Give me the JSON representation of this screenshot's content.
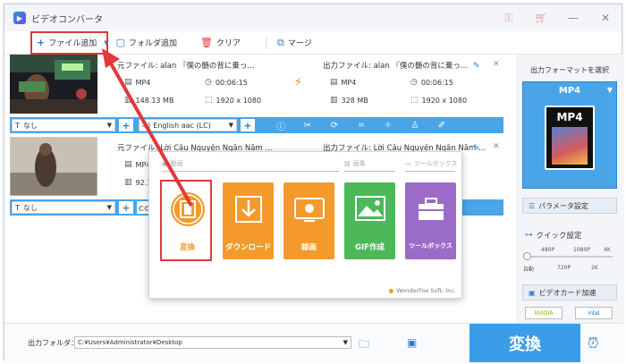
{
  "app": {
    "title": "ビデオコンバータ"
  },
  "toolbar": {
    "add_file": "ファイル追加",
    "add_folder": "フォルダ追加",
    "clear": "クリア",
    "merge": "マージ"
  },
  "files": [
    {
      "source_name": "元ファイル: alan 『僕の髄の背に乗っ...",
      "format": "MP4",
      "duration": "00:06:15",
      "size": "148.13 MB",
      "resolution": "1920 x 1080",
      "output_name": "出力ファイル: alan 『僕の髄の背に乗っ...",
      "out_format": "MP4",
      "out_duration": "00:06:15",
      "out_size": "328 MB",
      "out_resolution": "1920 x 1080",
      "subtitle": "なし",
      "audio": "English aac (LC)"
    },
    {
      "source_name": "元ファイル: Lời Câu Nguyện Ngân Năm ...",
      "format": "MP4",
      "size": "92.1",
      "output_name": "出力ファイル: Lời Câu Nguyện Ngân Năm ...",
      "subtitle": "なし"
    }
  ],
  "right_panel": {
    "title": "出力フォーマットを選択",
    "format": "MP4",
    "format_card": "MP4",
    "param_button": "パラメータ設定",
    "quick_settings": "クイック設定",
    "quality_top": [
      "480P",
      "1080P",
      "4K"
    ],
    "quality_bottom": [
      "自動",
      "720P",
      "2K"
    ],
    "gpu_button": "ビデオカード加速",
    "gpu_badges": [
      "NVIDIA",
      "intel"
    ]
  },
  "popup": {
    "section_video": "動画",
    "section_image": "画像",
    "section_toolbox": "ツールボックス",
    "tiles": [
      {
        "label": "変換",
        "color": "#f39a2b"
      },
      {
        "label": "ダウンロード",
        "color": "#f39a2b"
      },
      {
        "label": "録画",
        "color": "#f39a2b"
      },
      {
        "label": "GIF作成",
        "color": "#4cb85a"
      },
      {
        "label": "ツールボックス",
        "color": "#9b6cc7"
      }
    ],
    "footer": "WonderFox Soft, Inc."
  },
  "bottom": {
    "output_folder_label": "出力フォルダ：",
    "output_path": "C:¥Users¥Administrator¥Desktop",
    "convert_button": "変換"
  },
  "colors": {
    "accent": "#3a9de8",
    "highlight": "#e0383b"
  }
}
